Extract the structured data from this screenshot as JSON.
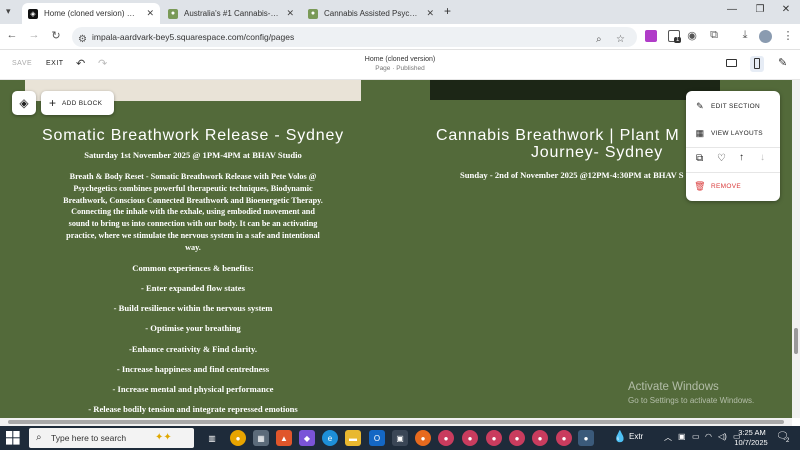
{
  "browser": {
    "tabs": [
      {
        "label": "Home (cloned version) — Psych",
        "active": true
      },
      {
        "label": "Australia's #1 Cannabis-Assiste",
        "active": false
      },
      {
        "label": "Cannabis Assisted Psychedelic",
        "active": false
      }
    ],
    "new_tab": "+",
    "url": "impala-aardvark-bey5.squarespace.com/config/pages",
    "extension_badge": "1"
  },
  "editor": {
    "save_label": "SAVE",
    "exit_label": "EXIT",
    "page_title": "Home (cloned version)",
    "page_status": "Page · Published"
  },
  "floating": {
    "add_block_label": "ADD BLOCK"
  },
  "section_menu": {
    "edit_section": "EDIT SECTION",
    "view_layouts": "VIEW LAYOUTS",
    "remove": "REMOVE"
  },
  "left_event": {
    "title": "Somatic Breathwork Release - Sydney",
    "date": "Saturday 1st November 2025 @ 1PM-4PM at BHAV Studio",
    "description_lines": [
      "Breath & Body Reset - Somatic Breathwork Release with Pete Volos @",
      "Psychegetics combines powerful therapeutic techniques, Biodynamic",
      "Breathwork, Conscious Connected Breathwork and Bioenergetic Therapy.",
      "Connecting the inhale with the exhale, using embodied movement and",
      "sound to bring us into connection with our body. It can be an activating",
      "practice, where we stimulate the nervous system in a safe and intentional",
      "way."
    ],
    "benefits_heading": "Common experiences & benefits:",
    "benefits": [
      "- Enter expanded flow states",
      "- Build resilience within the nervous system",
      "- Optimise your breathing",
      "-Enhance creativity & Find clarity.",
      "- Increase happiness and find centredness",
      "- Increase mental and physical performance",
      "- Release bodily tension and integrate repressed emotions"
    ]
  },
  "right_event": {
    "title_line1": "Cannabis Breathwork | Plant M",
    "title_line2": "Journey- Sydney",
    "date": "Sunday - 2nd of November 2025 @12PM-4:30PM at BHAV S"
  },
  "watermark": {
    "line1": "Activate Windows",
    "line2": "Go to Settings to activate Windows."
  },
  "taskbar": {
    "search_placeholder": "Type here to search",
    "weather": "Extr",
    "time": "3:25 AM",
    "date": "10/7/2025",
    "notification_count": "2"
  },
  "colors": {
    "section_bg": "#536a3a",
    "taskbar_bg": "#1e2b3a",
    "remove_red": "#d93a3a"
  }
}
